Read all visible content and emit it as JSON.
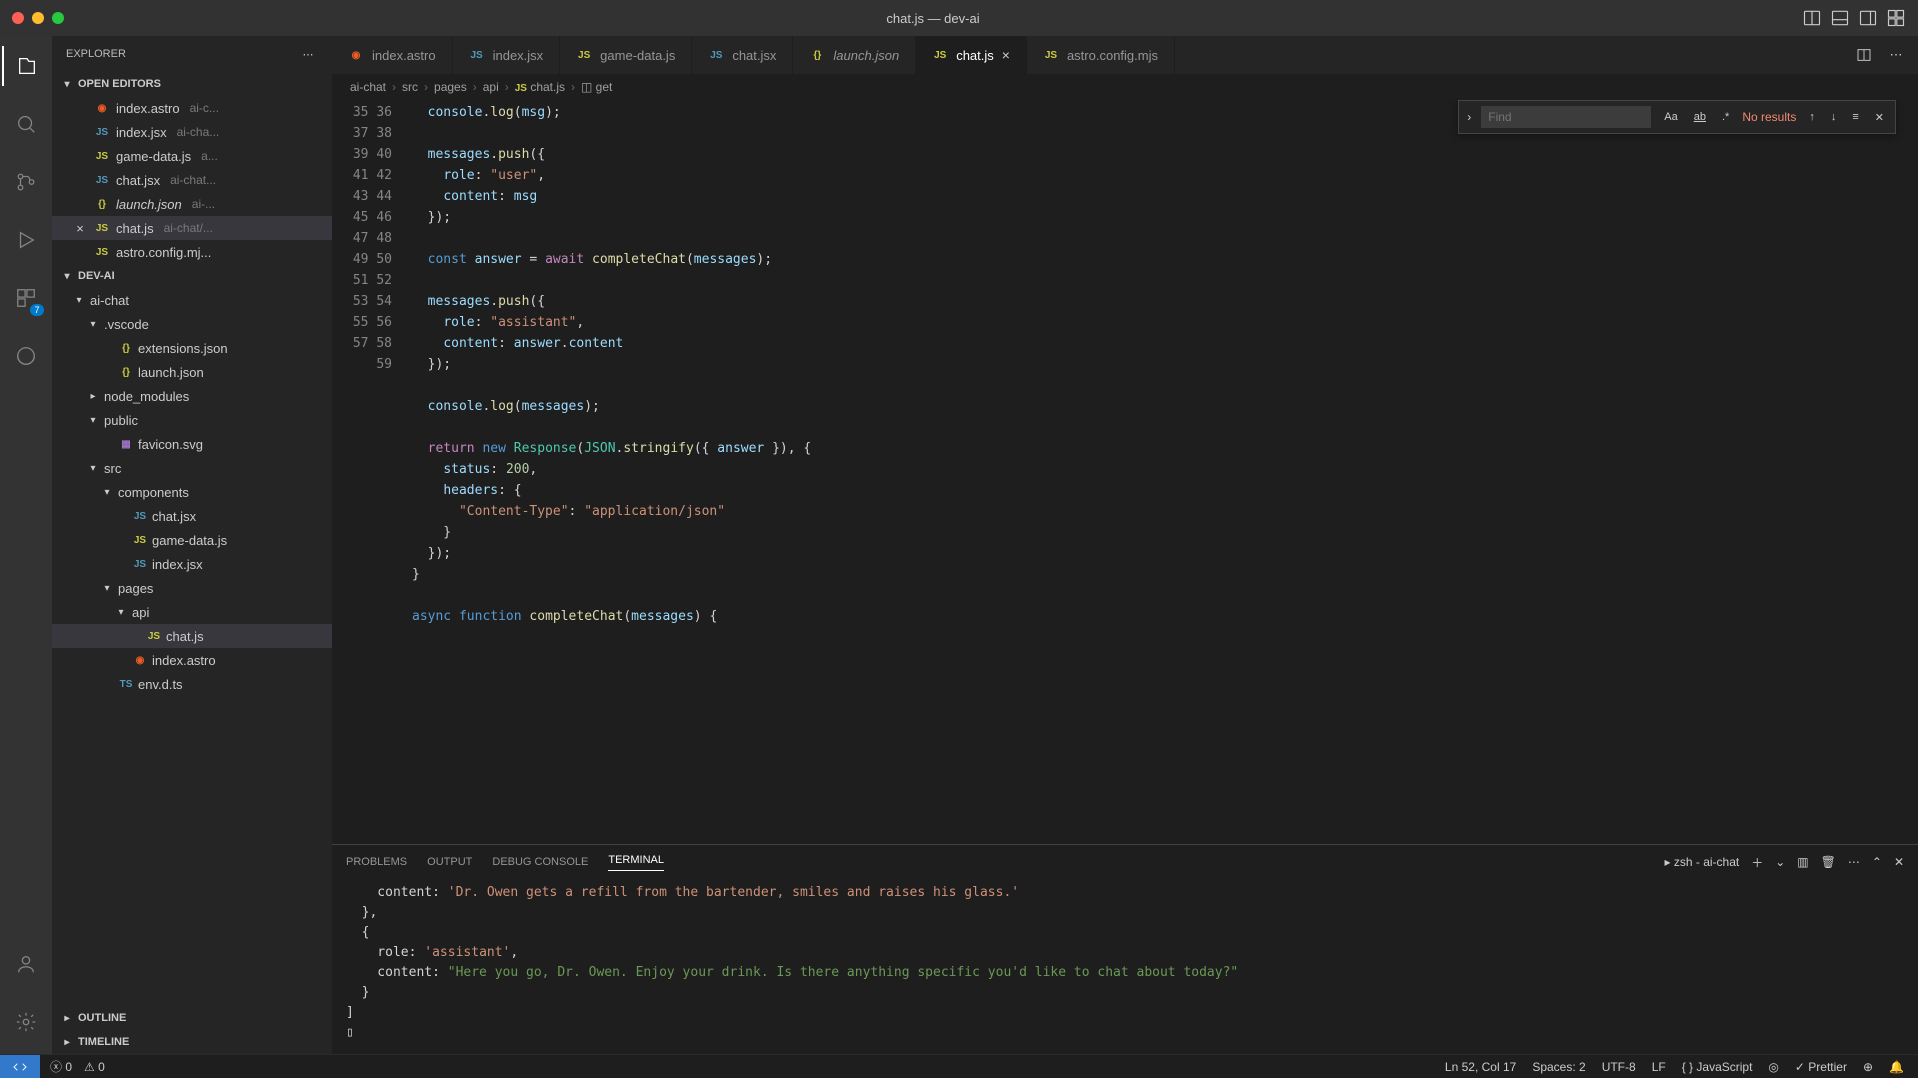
{
  "window": {
    "title": "chat.js — dev-ai"
  },
  "sidebar": {
    "title": "EXPLORER",
    "open_editors_label": "OPEN EDITORS",
    "open_editors": [
      {
        "name": "index.astro",
        "desc": "ai-c..."
      },
      {
        "name": "index.jsx",
        "desc": "ai-cha..."
      },
      {
        "name": "game-data.js",
        "desc": "a..."
      },
      {
        "name": "chat.jsx",
        "desc": "ai-chat..."
      },
      {
        "name": "launch.json",
        "desc": "ai-...",
        "italic": true
      },
      {
        "name": "chat.js",
        "desc": "ai-chat/...",
        "active": true
      },
      {
        "name": "astro.config.mj...",
        "desc": ""
      }
    ],
    "project_label": "DEV-AI",
    "tree": [
      {
        "indent": 1,
        "chev": "v",
        "name": "ai-chat"
      },
      {
        "indent": 2,
        "chev": "v",
        "name": ".vscode"
      },
      {
        "indent": 3,
        "icon": "json",
        "name": "extensions.json"
      },
      {
        "indent": 3,
        "icon": "json",
        "name": "launch.json"
      },
      {
        "indent": 2,
        "chev": ">",
        "name": "node_modules"
      },
      {
        "indent": 2,
        "chev": "v",
        "name": "public"
      },
      {
        "indent": 3,
        "icon": "svg",
        "name": "favicon.svg"
      },
      {
        "indent": 2,
        "chev": "v",
        "name": "src"
      },
      {
        "indent": 3,
        "chev": "v",
        "name": "components"
      },
      {
        "indent": 4,
        "icon": "jsx",
        "name": "chat.jsx"
      },
      {
        "indent": 4,
        "icon": "js",
        "name": "game-data.js"
      },
      {
        "indent": 4,
        "icon": "jsx",
        "name": "index.jsx"
      },
      {
        "indent": 3,
        "chev": "v",
        "name": "pages"
      },
      {
        "indent": 4,
        "chev": "v",
        "name": "api"
      },
      {
        "indent": 5,
        "icon": "js",
        "name": "chat.js",
        "selected": true
      },
      {
        "indent": 4,
        "icon": "astro",
        "name": "index.astro"
      },
      {
        "indent": 3,
        "icon": "ts",
        "name": "env.d.ts"
      }
    ],
    "outline_label": "OUTLINE",
    "timeline_label": "TIMELINE"
  },
  "tabs": [
    {
      "icon": "astro",
      "label": "index.astro"
    },
    {
      "icon": "jsx",
      "label": "index.jsx"
    },
    {
      "icon": "js",
      "label": "game-data.js"
    },
    {
      "icon": "jsx",
      "label": "chat.jsx"
    },
    {
      "icon": "json",
      "label": "launch.json",
      "italic": true
    },
    {
      "icon": "js",
      "label": "chat.js",
      "active": true,
      "close": true
    },
    {
      "icon": "js",
      "label": "astro.config.mjs"
    }
  ],
  "breadcrumb": [
    "ai-chat",
    "src",
    "pages",
    "api",
    "chat.js",
    "get"
  ],
  "find": {
    "placeholder": "Find",
    "results": "No results"
  },
  "code_start_line": 35,
  "code_end_line": 59,
  "panel": {
    "tabs": [
      "PROBLEMS",
      "OUTPUT",
      "DEBUG CONSOLE",
      "TERMINAL"
    ],
    "active_tab": 3,
    "terminal_label": "zsh - ai-chat"
  },
  "terminal_lines": [
    {
      "indent": 4,
      "pre": "content: ",
      "str": "'Dr. Owen gets a refill from the bartender, smiles and raises his glass.'"
    },
    {
      "indent": 2,
      "pre": "},"
    },
    {
      "indent": 2,
      "pre": "{"
    },
    {
      "indent": 4,
      "pre": "role: ",
      "str": "'assistant'",
      "post": ","
    },
    {
      "indent": 4,
      "pre": "content: ",
      "str2": "\"Here you go, Dr. Owen. Enjoy your drink. Is there anything specific you'd like to chat about today?\""
    },
    {
      "indent": 2,
      "pre": "}"
    },
    {
      "indent": 0,
      "pre": "]"
    },
    {
      "indent": 0,
      "pre": "▯"
    }
  ],
  "status": {
    "errors": "0",
    "warnings": "0",
    "ln_col": "Ln 52, Col 17",
    "spaces": "Spaces: 2",
    "encoding": "UTF-8",
    "eol": "LF",
    "lang": "JavaScript",
    "prettier": "Prettier"
  },
  "activity_badge": "7"
}
